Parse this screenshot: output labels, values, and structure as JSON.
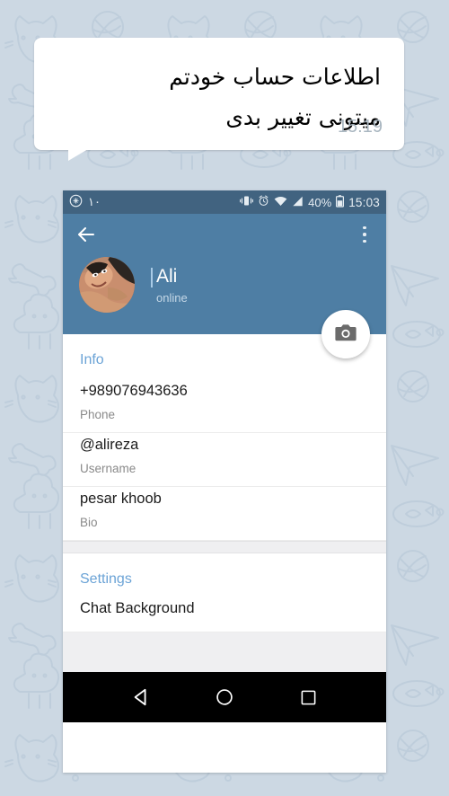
{
  "wallpaper": {
    "color": "#ccd8e3",
    "doodle_color": "#b6c7d6"
  },
  "chat_message": {
    "text_line1": "اطلاعات حساب خودتم",
    "text_line2": "میتونی تغییر بدی",
    "time": "15:19"
  },
  "phone": {
    "status_bar": {
      "app_icon": "telegram-icon",
      "notification_count": "۱۰",
      "vibrate_icon": "vibrate-icon",
      "alarm_icon": "alarm-icon",
      "wifi_icon": "wifi-icon",
      "signal_icon": "signal-icon",
      "battery_percent": "40%",
      "battery_icon": "battery-icon",
      "time": "15:03"
    },
    "app_bar": {
      "back_icon": "back-arrow-icon",
      "menu_icon": "overflow-menu-icon",
      "avatar_icon": "user-avatar",
      "name": "Ali",
      "status": "online",
      "fab_icon": "camera-icon",
      "bg_color": "#4e7ea4"
    },
    "info_section": {
      "title": "Info",
      "rows": [
        {
          "value": "+989076943636",
          "label": "Phone"
        },
        {
          "value": "@alireza",
          "label": "Username"
        },
        {
          "value": "pesar khoob",
          "label": "Bio"
        }
      ]
    },
    "settings_section": {
      "title": "Settings",
      "items": [
        {
          "label": "Chat Background"
        }
      ]
    },
    "nav_bar": {
      "back": "nav-back-icon",
      "home": "nav-home-icon",
      "recents": "nav-recents-icon"
    }
  }
}
